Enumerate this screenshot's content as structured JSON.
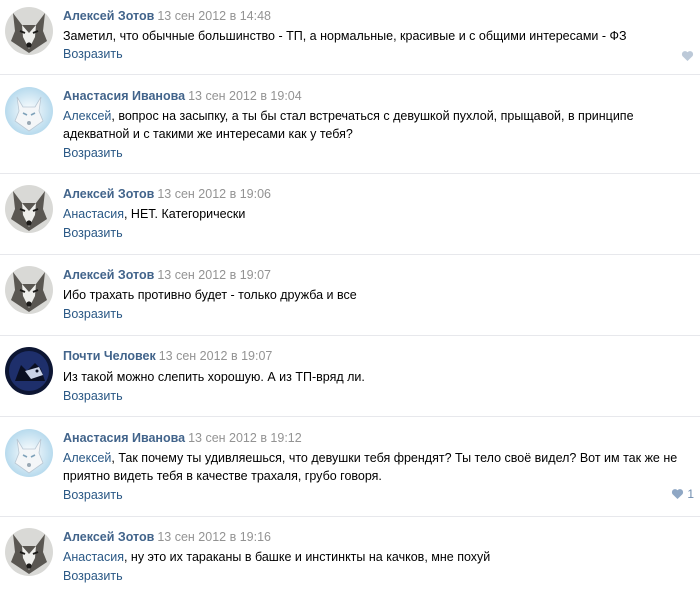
{
  "comments": [
    {
      "author": "Алексей Зотов",
      "date": "13 сен 2012 в 14:48",
      "mention": "",
      "text": "Заметил, что обычные большинство - ТП, а нормальные, красивые и с общими интересами - ФЗ",
      "reply_label": "Возразить",
      "likes": "",
      "avatar_icon": "wolf-icon"
    },
    {
      "author": "Анастасия Иванова",
      "date": "13 сен 2012 в 19:04",
      "mention": "Алексей",
      "text": ", вопрос на засыпку, а ты бы стал встречаться с девушкой пухлой, прыщавой, в принципе адекватной и с такими же интересами как у тебя?",
      "reply_label": "Возразить",
      "likes": "",
      "avatar_icon": "white-wolf-icon"
    },
    {
      "author": "Алексей Зотов",
      "date": "13 сен 2012 в 19:06",
      "mention": "Анастасия",
      "text": ", НЕТ. Категорически",
      "reply_label": "Возразить",
      "likes": "",
      "avatar_icon": "wolf-icon"
    },
    {
      "author": "Алексей Зотов",
      "date": "13 сен 2012 в 19:07",
      "mention": "",
      "text": "Ибо трахать противно будет - только дружба и все",
      "reply_label": "Возразить",
      "likes": "",
      "avatar_icon": "wolf-icon"
    },
    {
      "author": "Почти Человек",
      "date": "13 сен 2012 в 19:07",
      "mention": "",
      "text": "Из такой можно слепить хорошую. А из ТП-вряд ли.",
      "reply_label": "Возразить",
      "likes": "",
      "avatar_icon": "dark-wolf-icon"
    },
    {
      "author": "Анастасия Иванова",
      "date": "13 сен 2012 в 19:12",
      "mention": "Алексей",
      "text": ", Так почему ты удивляешься, что девушки тебя френдят? Ты тело своё видел? Вот им так же не приятно видеть тебя в качестве трахаля, грубо говоря.",
      "reply_label": "Возразить",
      "likes": "1",
      "avatar_icon": "white-wolf-icon"
    },
    {
      "author": "Алексей Зотов",
      "date": "13 сен 2012 в 19:16",
      "mention": "Анастасия",
      "text": ", ну это их тараканы в башке и инстинкты на качков, мне похуй",
      "reply_label": "Возразить",
      "likes": "",
      "avatar_icon": "wolf-icon"
    }
  ],
  "colors": {
    "author": "#42648b",
    "date": "#939393",
    "link": "#2a5885",
    "divider": "#e7e8ec",
    "like": "#6f8cae"
  },
  "like_icon": "heart-icon"
}
